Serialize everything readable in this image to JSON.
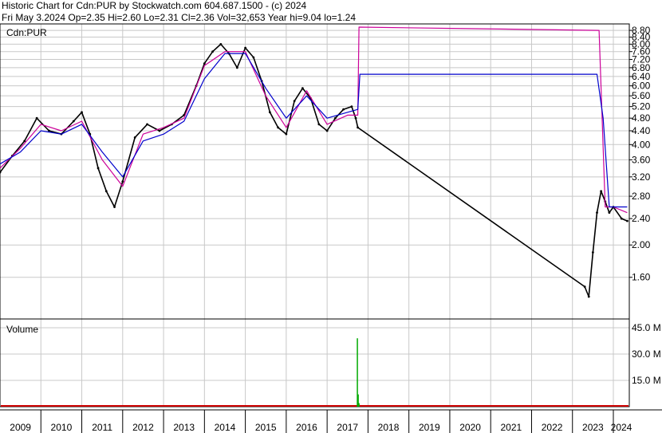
{
  "header": {
    "line1": "Historic Chart for Cdn:PUR by Stockwatch.com 604.687.1500 - (c) 2024",
    "line2": "Fri May  3.2024   Op=2.35   Hi=2.60   Lo=2.31   Cl=2.36   Vol=32,653   Year hi=9.04   lo=1.24"
  },
  "chart_data": [
    {
      "type": "line",
      "panel_label": "Cdn:PUR",
      "ylim": [
        1.2,
        9.2
      ],
      "y_scale": "log",
      "y_ticks": [
        "8.80",
        "8.40",
        "8.00",
        "7.60",
        "7.20",
        "6.80",
        "6.40",
        "6.00",
        "5.60",
        "5.20",
        "4.80",
        "4.40",
        "4.00",
        "3.60",
        "3.20",
        "2.80",
        "2.40",
        "2.00",
        "1.60"
      ],
      "x_ticks": [
        "2009",
        "2010",
        "2011",
        "2012",
        "2013",
        "2014",
        "2015",
        "2016",
        "2017",
        "2018",
        "2019",
        "2020",
        "2021",
        "2022",
        "2023",
        "2024"
      ],
      "grid": true,
      "colors": {
        "price": "#000000",
        "ma_short": "#cc0099",
        "ma_long": "#0000cc"
      },
      "series": [
        {
          "role": "price",
          "x": [
            2009.0,
            2009.3,
            2009.6,
            2009.9,
            2010.2,
            2010.5,
            2010.8,
            2011.0,
            2011.2,
            2011.4,
            2011.6,
            2011.8,
            2012.0,
            2012.3,
            2012.6,
            2012.9,
            2013.2,
            2013.5,
            2013.8,
            2014.0,
            2014.2,
            2014.4,
            2014.6,
            2014.8,
            2015.0,
            2015.2,
            2015.4,
            2015.6,
            2015.8,
            2016.0,
            2016.2,
            2016.4,
            2016.6,
            2016.8,
            2017.0,
            2017.2,
            2017.4,
            2017.6,
            2017.7,
            2017.75,
            2023.3,
            2023.4,
            2023.5,
            2023.6,
            2023.7,
            2023.8,
            2023.9,
            2024.0,
            2024.2,
            2024.34
          ],
          "y": [
            3.3,
            3.7,
            4.1,
            4.8,
            4.4,
            4.3,
            4.7,
            5.0,
            4.3,
            3.4,
            2.9,
            2.6,
            3.1,
            4.2,
            4.6,
            4.4,
            4.6,
            4.9,
            6.0,
            7.0,
            7.6,
            8.0,
            7.5,
            6.8,
            7.8,
            7.3,
            6.2,
            5.0,
            4.5,
            4.3,
            5.4,
            5.9,
            5.5,
            4.6,
            4.4,
            4.8,
            5.1,
            5.2,
            4.8,
            4.5,
            1.5,
            1.4,
            1.9,
            2.5,
            2.9,
            2.7,
            2.5,
            2.6,
            2.4,
            2.36
          ]
        },
        {
          "role": "ma_short",
          "x": [
            2009.0,
            2009.5,
            2010.0,
            2010.5,
            2011.0,
            2011.5,
            2012.0,
            2012.5,
            2013.0,
            2013.5,
            2014.0,
            2014.5,
            2015.0,
            2015.5,
            2016.0,
            2016.5,
            2017.0,
            2017.5,
            2017.75,
            2017.78,
            2023.65,
            2023.8,
            2024.0,
            2024.34
          ],
          "y": [
            3.4,
            3.9,
            4.6,
            4.4,
            4.7,
            3.6,
            3.0,
            4.3,
            4.5,
            4.8,
            6.9,
            7.6,
            7.6,
            5.6,
            4.5,
            5.8,
            4.6,
            4.9,
            4.9,
            9.0,
            8.8,
            2.6,
            2.6,
            2.5
          ]
        },
        {
          "role": "ma_long",
          "x": [
            2009.0,
            2009.5,
            2010.0,
            2010.5,
            2011.0,
            2011.5,
            2012.0,
            2012.5,
            2013.0,
            2013.5,
            2014.0,
            2014.5,
            2015.0,
            2015.5,
            2016.0,
            2016.5,
            2017.0,
            2017.5,
            2017.75,
            2017.8,
            2023.6,
            2023.75,
            2023.9,
            2024.34
          ],
          "y": [
            3.5,
            3.8,
            4.4,
            4.3,
            4.6,
            3.8,
            3.2,
            4.1,
            4.3,
            4.7,
            6.3,
            7.5,
            7.5,
            5.9,
            4.8,
            5.6,
            4.8,
            5.0,
            5.1,
            6.5,
            6.5,
            4.8,
            2.6,
            2.6
          ]
        }
      ]
    },
    {
      "type": "bar",
      "panel_label": "Volume",
      "ylim": [
        0,
        50
      ],
      "y_ticks": [
        "45.0 M",
        "30.0 M",
        "15.0 M"
      ],
      "grid": true,
      "colors": {
        "volume": "#00aa00",
        "baseline": "#cc0000"
      },
      "bars": [
        {
          "x": 2017.74,
          "value": 39.0
        },
        {
          "x": 2017.76,
          "value": 7.0
        },
        {
          "x": 2017.78,
          "value": 2.0
        }
      ]
    }
  ]
}
